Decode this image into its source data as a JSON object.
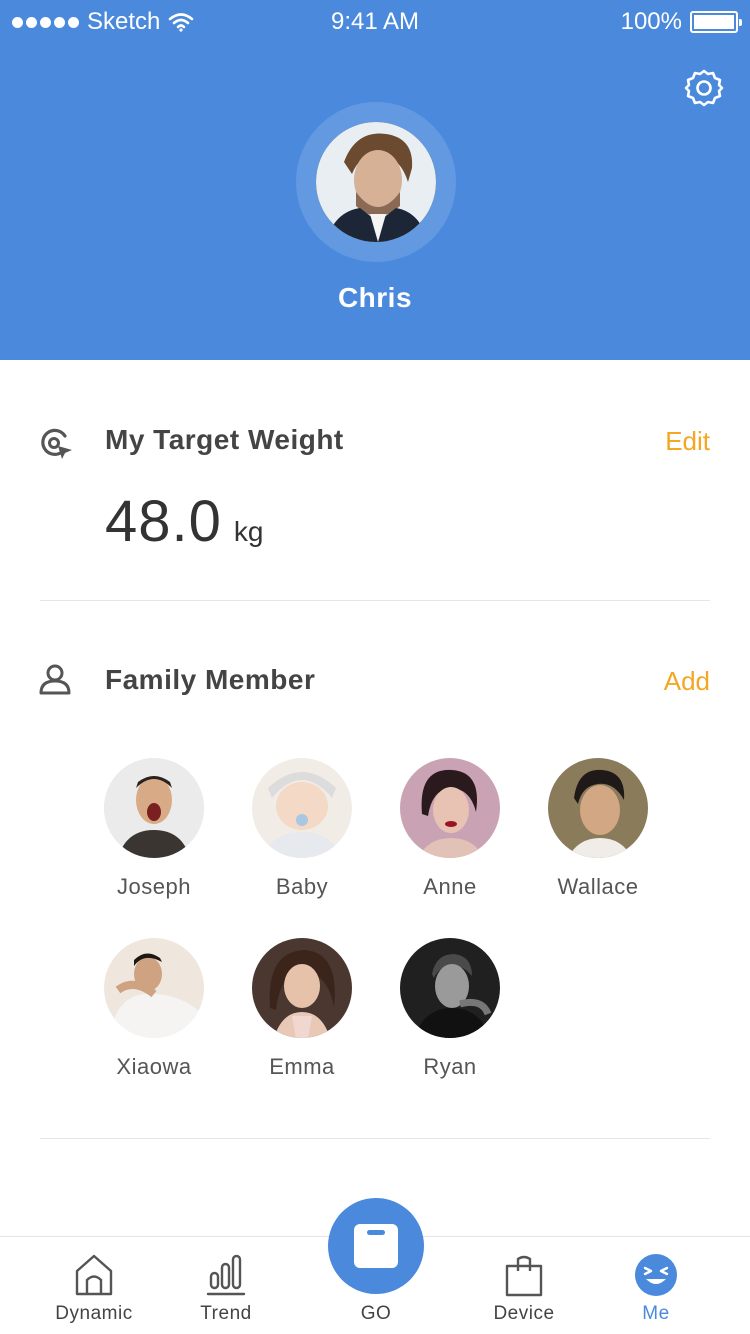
{
  "status_bar": {
    "carrier": "Sketch",
    "time": "9:41 AM",
    "battery": "100%"
  },
  "profile": {
    "name": "Chris"
  },
  "target_weight": {
    "title": "My Target Weight",
    "action": "Edit",
    "value": "48.0",
    "unit": "kg"
  },
  "family": {
    "title": "Family Member",
    "action": "Add",
    "members": [
      {
        "name": "Joseph"
      },
      {
        "name": "Baby"
      },
      {
        "name": "Anne"
      },
      {
        "name": "Wallace"
      },
      {
        "name": "Xiaowa"
      },
      {
        "name": "Emma"
      },
      {
        "name": "Ryan"
      }
    ]
  },
  "tabs": [
    {
      "label": "Dynamic",
      "icon": "home-icon"
    },
    {
      "label": "Trend",
      "icon": "bar-chart-icon"
    },
    {
      "label": "GO",
      "icon": "scale-icon"
    },
    {
      "label": "Device",
      "icon": "bag-icon"
    },
    {
      "label": "Me",
      "icon": "smile-face-icon",
      "active": true
    }
  ],
  "colors": {
    "primary": "#4a89dc",
    "accent": "#f5a623"
  }
}
